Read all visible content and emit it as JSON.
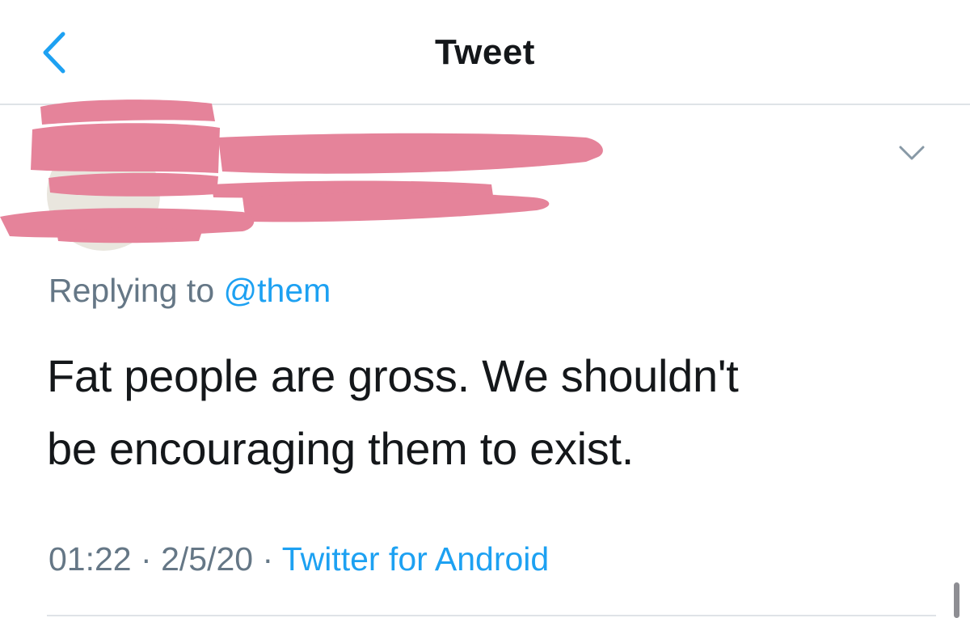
{
  "nav": {
    "title": "Tweet",
    "back_icon": "chevron-left-icon"
  },
  "tweet": {
    "author_name": "",
    "author_handle": "",
    "more_icon": "chevron-down-icon",
    "replying_prefix": "Replying to",
    "replying_handle": "@them",
    "text_line1": "Fat people are gross. We shouldn't",
    "text_line2": "be encouraging them to exist.",
    "time": "01:22",
    "separator": "·",
    "date": "2/5/20",
    "source": "Twitter for Android"
  },
  "colors": {
    "accent": "#1da1f2",
    "secondary_text": "#657786",
    "primary_text": "#14171a",
    "divider": "#dfe3e7",
    "redaction": "#e5839a"
  }
}
